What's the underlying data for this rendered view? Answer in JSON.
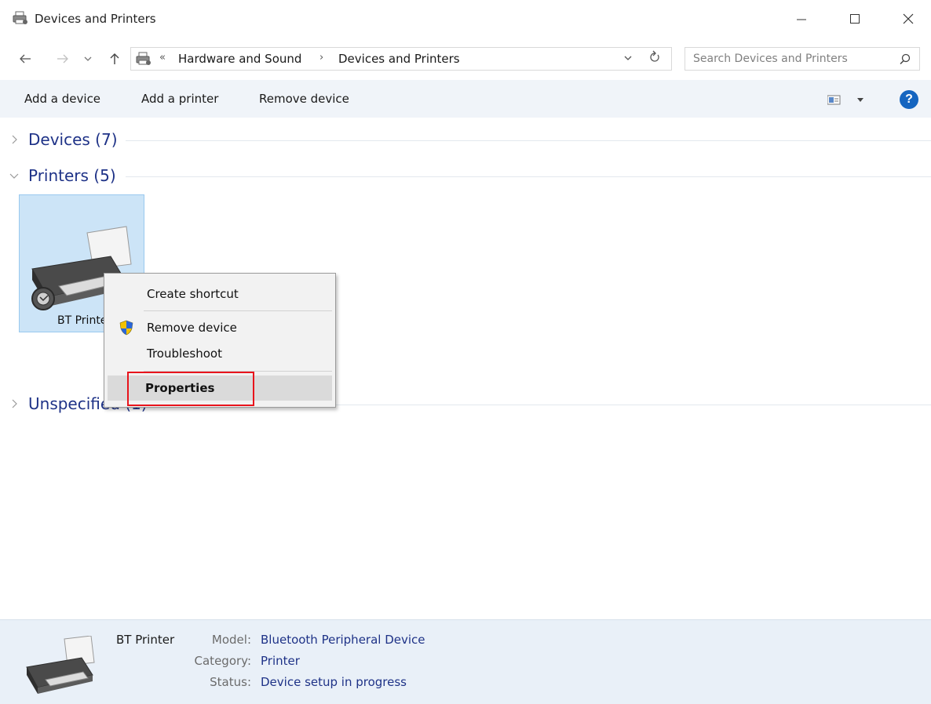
{
  "window": {
    "title": "Devices and Printers",
    "controls": {
      "minimize": "—",
      "maximize": "☐",
      "close": "✕"
    }
  },
  "address_bar": {
    "overflow": "«",
    "breadcrumbs": [
      "Hardware and Sound",
      "Devices and Printers"
    ],
    "separator": "›",
    "search_placeholder": "Search Devices and Printers"
  },
  "command_bar": {
    "items": [
      "Add a device",
      "Add a printer",
      "Remove device"
    ],
    "help_label": "?"
  },
  "groups": {
    "devices": "Devices (7)",
    "printers": "Printers (5)",
    "unspecified": "Unspecified (1)"
  },
  "printer_tile": {
    "label": "BT Printer"
  },
  "context_menu": {
    "items": [
      "Create shortcut",
      "Remove device",
      "Troubleshoot",
      "Properties"
    ],
    "highlighted": "Properties"
  },
  "details": {
    "name": "BT Printer",
    "fields": [
      {
        "key": "Model:",
        "value": "Bluetooth Peripheral Device"
      },
      {
        "key": "Category:",
        "value": "Printer"
      },
      {
        "key": "Status:",
        "value": "Device setup in progress"
      }
    ]
  },
  "colors": {
    "accent_text": "#1e3287",
    "selection_bg": "#cce4f7",
    "highlight_box": "#e8141c",
    "help_icon": "#1565c0"
  }
}
